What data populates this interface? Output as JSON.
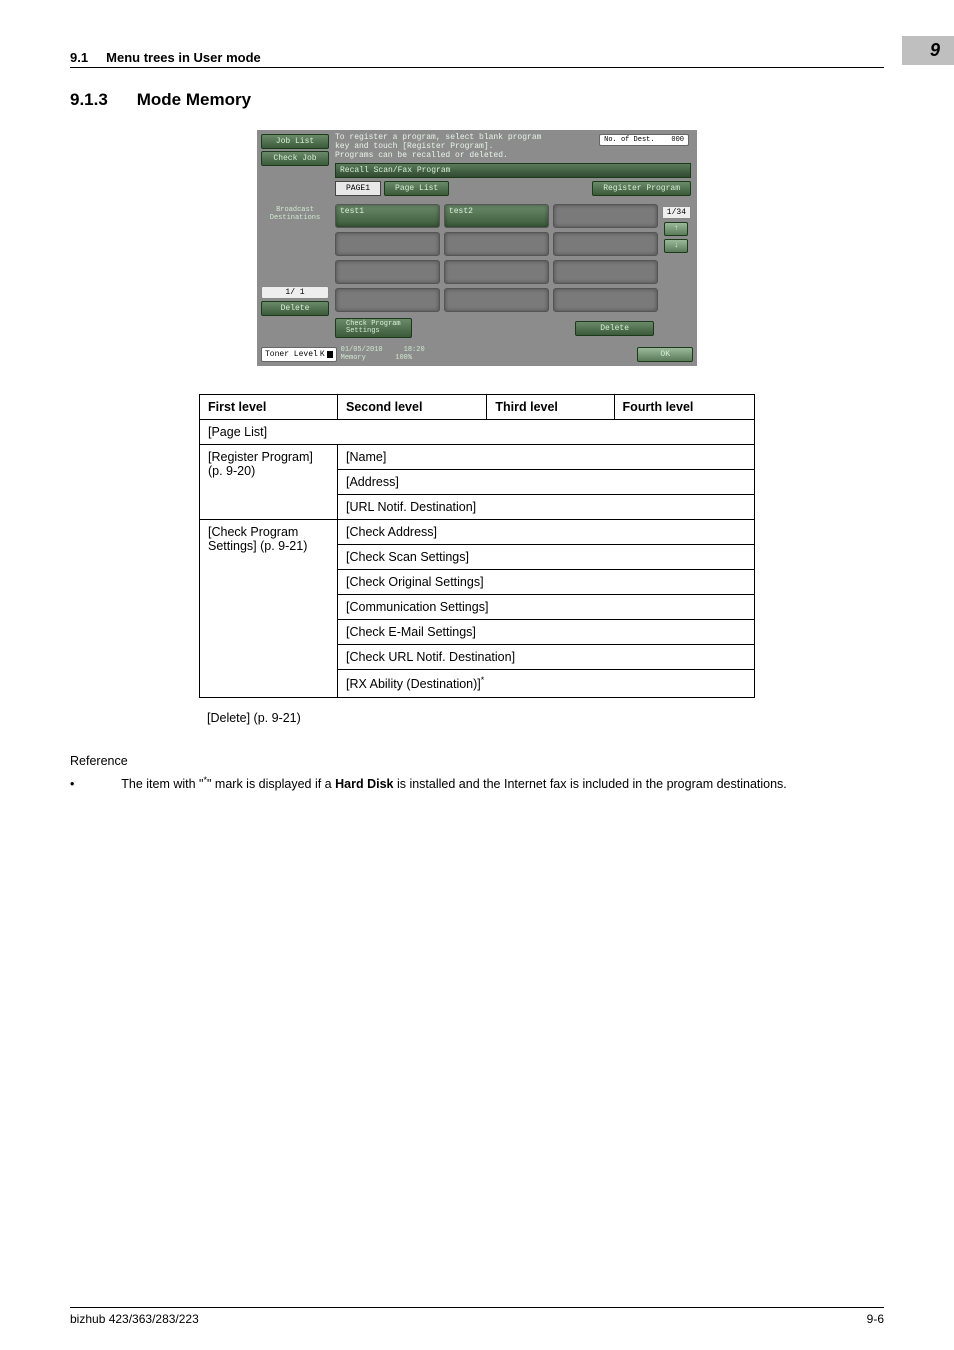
{
  "header": {
    "section_num": "9.1",
    "section_title": "Menu trees in User mode",
    "chapter": "9"
  },
  "title": {
    "num": "9.1.3",
    "text": "Mode Memory"
  },
  "screen": {
    "job_list": "Job List",
    "check_job": "Check Job",
    "msg_l1": "To register a program, select blank program",
    "msg_l2": "key and touch [Register Program].",
    "msg_l3": "Programs can be recalled or deleted.",
    "tab": "Recall Scan/Fax Program",
    "page_btn": "PAGE1",
    "page_list": "Page List",
    "register": "Register Program",
    "test1": "test1",
    "test2": "test2",
    "page_ind": "1/34",
    "up": "↑",
    "down": "↓",
    "broadcast": "Broadcast\nDestinations",
    "ratio": "1/  1",
    "delete_side": "Delete",
    "check_prog": "Check Program\nSettings",
    "delete_mid": "Delete",
    "ok": "OK",
    "toner": "Toner Level",
    "k": "K",
    "date": "01/05/2010",
    "time": "18:20",
    "memory": "Memory",
    "mem_pct": "100%",
    "no_dest_lbl": "No. of Dest.",
    "no_dest_val": "000"
  },
  "table": {
    "h1": "First level",
    "h2": "Second level",
    "h3": "Third level",
    "h4": "Fourth level",
    "r_pagelist": "[Page List]",
    "r_regprog": "[Register Program] (p. 9-20)",
    "r_name": "[Name]",
    "r_address": "[Address]",
    "r_url": "[URL Notif. Destination]",
    "r_check": "[Check Program Settings] (p. 9-21)",
    "r_checkaddr": "[Check Address]",
    "r_checkscan": "[Check Scan Settings]",
    "r_checkorig": "[Check Original Settings]",
    "r_comm": "[Communication Settings]",
    "r_email": "[Check E-Mail Settings]",
    "r_checkurl": "[Check URL Notif. Destination]",
    "r_rx": "[RX Ability (Destination)]",
    "r_delete": "[Delete] (p. 9-21)"
  },
  "ref": {
    "label": "Reference",
    "bullet1_a": "The item with \"",
    "bullet1_b": "\" mark is displayed if a ",
    "hard_disk": "Hard Disk",
    "bullet1_c": " is installed and the Internet fax is included in the program destinations."
  },
  "footer": {
    "left": "bizhub 423/363/283/223",
    "right": "9-6"
  }
}
